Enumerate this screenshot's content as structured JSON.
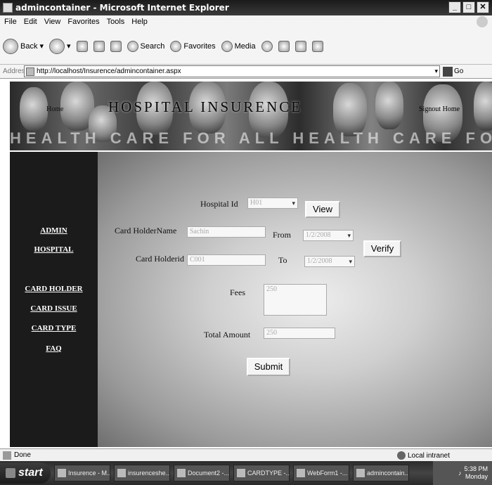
{
  "window": {
    "title": "admincontainer - Microsoft Internet Explorer"
  },
  "menu": [
    "File",
    "Edit",
    "View",
    "Favorites",
    "Tools",
    "Help"
  ],
  "toolbar": {
    "back": "Back",
    "search": "Search",
    "favorites": "Favorites",
    "media": "Media"
  },
  "address": {
    "label": "Address",
    "url": "http://localhost/Insurence/admincontainer.aspx",
    "go": "Go"
  },
  "banner": {
    "home": "Home",
    "site_name": "HOSPITAL INSURENCE",
    "signout": "Signout Home",
    "tagline": "HEALTH CARE FOR ALL HEALTH CARE FOR ALL HE"
  },
  "sidebar": {
    "items": [
      {
        "label": "ADMIN"
      },
      {
        "label": "HOSPITAL"
      },
      {
        "label": "CARD HOLDER"
      },
      {
        "label": "CARD ISSUE"
      },
      {
        "label": "CARD TYPE"
      },
      {
        "label": "FAQ"
      }
    ]
  },
  "form": {
    "hospital_id_label": "Hospital Id",
    "hospital_id_value": "H01",
    "view_button": "View",
    "card_holder_name_label": "Card HolderName",
    "card_holder_name_value": "Sachin",
    "from_label": "From",
    "from_value": "1/2/2008",
    "verify_button": "Verify",
    "card_holder_id_label": "Card Holderid",
    "card_holder_id_value": "C001",
    "to_label": "To",
    "to_value": "1/2/2008",
    "fees_label": "Fees",
    "fees_value": "250",
    "total_amount_label": "Total Amount",
    "total_amount_value": "250",
    "submit_button": "Submit"
  },
  "status": {
    "text": "Done",
    "zone": "Local intranet"
  },
  "taskbar": {
    "start": "start",
    "tasks": [
      "Insurence - M...",
      "insurenceshe...",
      "Document2 -...",
      "CARDTYPE -...",
      "WebForm1 -...",
      "admincontain..."
    ],
    "time": "5:38 PM",
    "day": "Monday"
  }
}
